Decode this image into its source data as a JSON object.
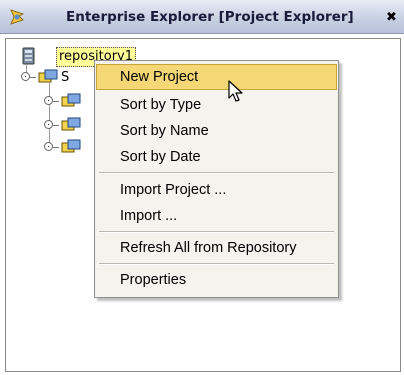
{
  "window": {
    "title": "Enterprise Explorer [Project Explorer]",
    "close_glyph": "✖",
    "title_icon": "explorer-icon"
  },
  "tree": {
    "root": {
      "label": "repository1",
      "icon": "repository-icon"
    },
    "children_partial": [
      {
        "visible_text": "S",
        "icon": "project-icon"
      },
      {
        "visible_text": "",
        "icon": "project-icon"
      },
      {
        "visible_text": "",
        "icon": "project-icon"
      },
      {
        "visible_text": "",
        "icon": "project-icon"
      }
    ]
  },
  "context_menu": {
    "items": [
      {
        "label": "New Project",
        "highlighted": true
      },
      {
        "label": "Sort by Type"
      },
      {
        "label": "Sort by Name"
      },
      {
        "label": "Sort by Date"
      },
      {
        "label": "Import Project ..."
      },
      {
        "label": "Import ..."
      },
      {
        "label": "Refresh All from Repository"
      },
      {
        "label": "Properties"
      }
    ],
    "highlight_color": "#f5d776"
  },
  "cursor": {
    "icon": "mouse-pointer-icon"
  }
}
